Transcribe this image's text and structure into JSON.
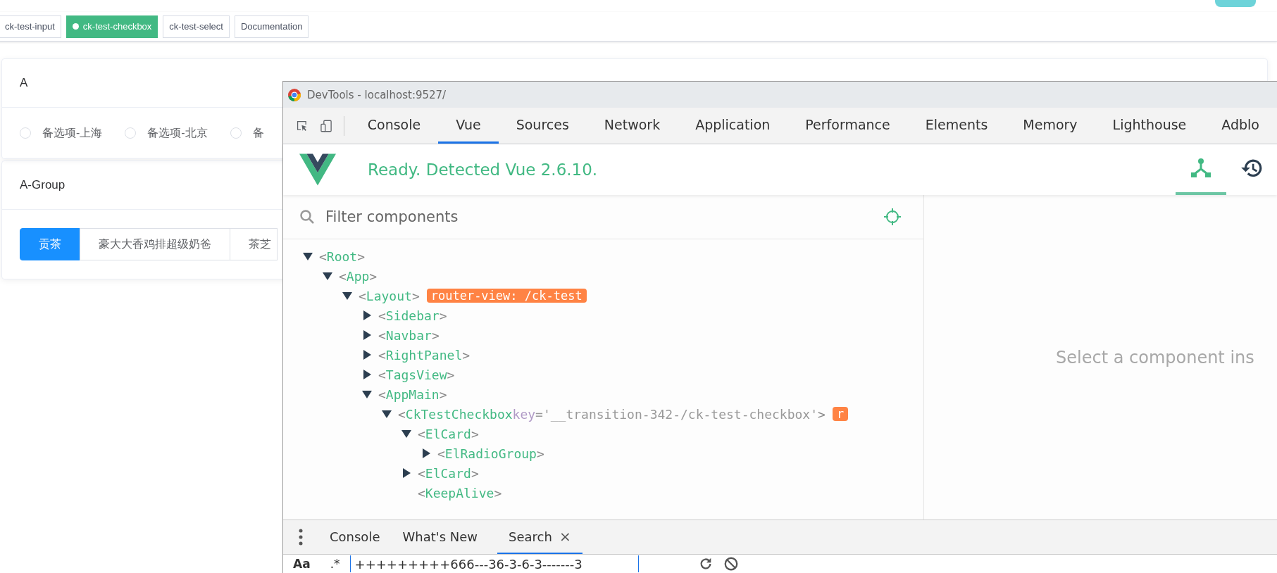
{
  "tags": [
    {
      "label": "ck-test-input",
      "selected": false
    },
    {
      "label": "ck-test-checkbox",
      "selected": true
    },
    {
      "label": "ck-test-select",
      "selected": false
    },
    {
      "label": "Documentation",
      "selected": false
    }
  ],
  "cards": [
    {
      "title": "A",
      "kind": "radio",
      "options": [
        {
          "label": "备选项-上海",
          "selected": false
        },
        {
          "label": "备选项-北京",
          "selected": false
        },
        {
          "label": "备",
          "selected": false
        }
      ]
    },
    {
      "title": "A-Group",
      "kind": "radio-button",
      "options": [
        {
          "label": "贡茶",
          "selected": true
        },
        {
          "label": "豪大大香鸡排超级奶爸",
          "selected": false
        },
        {
          "label": "茶芝",
          "selected": false
        }
      ]
    }
  ],
  "devtools": {
    "title": "DevTools - localhost:9527/",
    "tabs": [
      {
        "label": "Console",
        "selected": false
      },
      {
        "label": "Vue",
        "selected": true
      },
      {
        "label": "Sources",
        "selected": false
      },
      {
        "label": "Network",
        "selected": false
      },
      {
        "label": "Application",
        "selected": false
      },
      {
        "label": "Performance",
        "selected": false
      },
      {
        "label": "Elements",
        "selected": false
      },
      {
        "label": "Memory",
        "selected": false
      },
      {
        "label": "Lighthouse",
        "selected": false
      },
      {
        "label": "Adblo",
        "selected": false
      }
    ],
    "status": "Ready. Detected Vue 2.6.10.",
    "filter": {
      "placeholder": "Filter components"
    },
    "tree": {
      "open_bracket": "<",
      "close_bracket": ">",
      "nodes": [
        {
          "name": "Root",
          "kind": "branch",
          "expanded": true,
          "children": [
            {
              "name": "App",
              "kind": "branch",
              "expanded": true,
              "children": [
                {
                  "name": "Layout",
                  "kind": "branch",
                  "expanded": true,
                  "badge": "router-view: /ck-test",
                  "children": [
                    {
                      "name": "Sidebar",
                      "kind": "branch",
                      "expanded": false
                    },
                    {
                      "name": "Navbar",
                      "kind": "branch",
                      "expanded": false
                    },
                    {
                      "name": "RightPanel",
                      "kind": "branch",
                      "expanded": false
                    },
                    {
                      "name": "TagsView",
                      "kind": "branch",
                      "expanded": false
                    },
                    {
                      "name": "AppMain",
                      "kind": "branch",
                      "expanded": true,
                      "children": [
                        {
                          "name": "CkTestCheckbox",
                          "kind": "branch",
                          "expanded": true,
                          "attr_key": "key",
                          "attr_value": "='__transition-342-/ck-test-checkbox'",
                          "badge": "r",
                          "children": [
                            {
                              "name": "ElCard",
                              "kind": "branch",
                              "expanded": true,
                              "children": [
                                {
                                  "name": "ElRadioGroup",
                                  "kind": "branch",
                                  "expanded": false
                                }
                              ]
                            },
                            {
                              "name": "ElCard",
                              "kind": "branch",
                              "expanded": false
                            },
                            {
                              "name": "KeepAlive",
                              "kind": "leaf"
                            }
                          ]
                        }
                      ]
                    }
                  ]
                }
              ]
            }
          ]
        }
      ]
    },
    "empty_message": "Select a component ins",
    "drawer_tabs": [
      {
        "label": "Console",
        "selected": false,
        "closable": false
      },
      {
        "label": "What's New",
        "selected": false,
        "closable": false
      },
      {
        "label": "Search",
        "selected": true,
        "closable": true
      }
    ],
    "close_glyph": "×",
    "search": {
      "case_label": "Aa",
      "regex_label": ".*",
      "value": "+++++++++666---36-3-6-3-------3"
    }
  }
}
